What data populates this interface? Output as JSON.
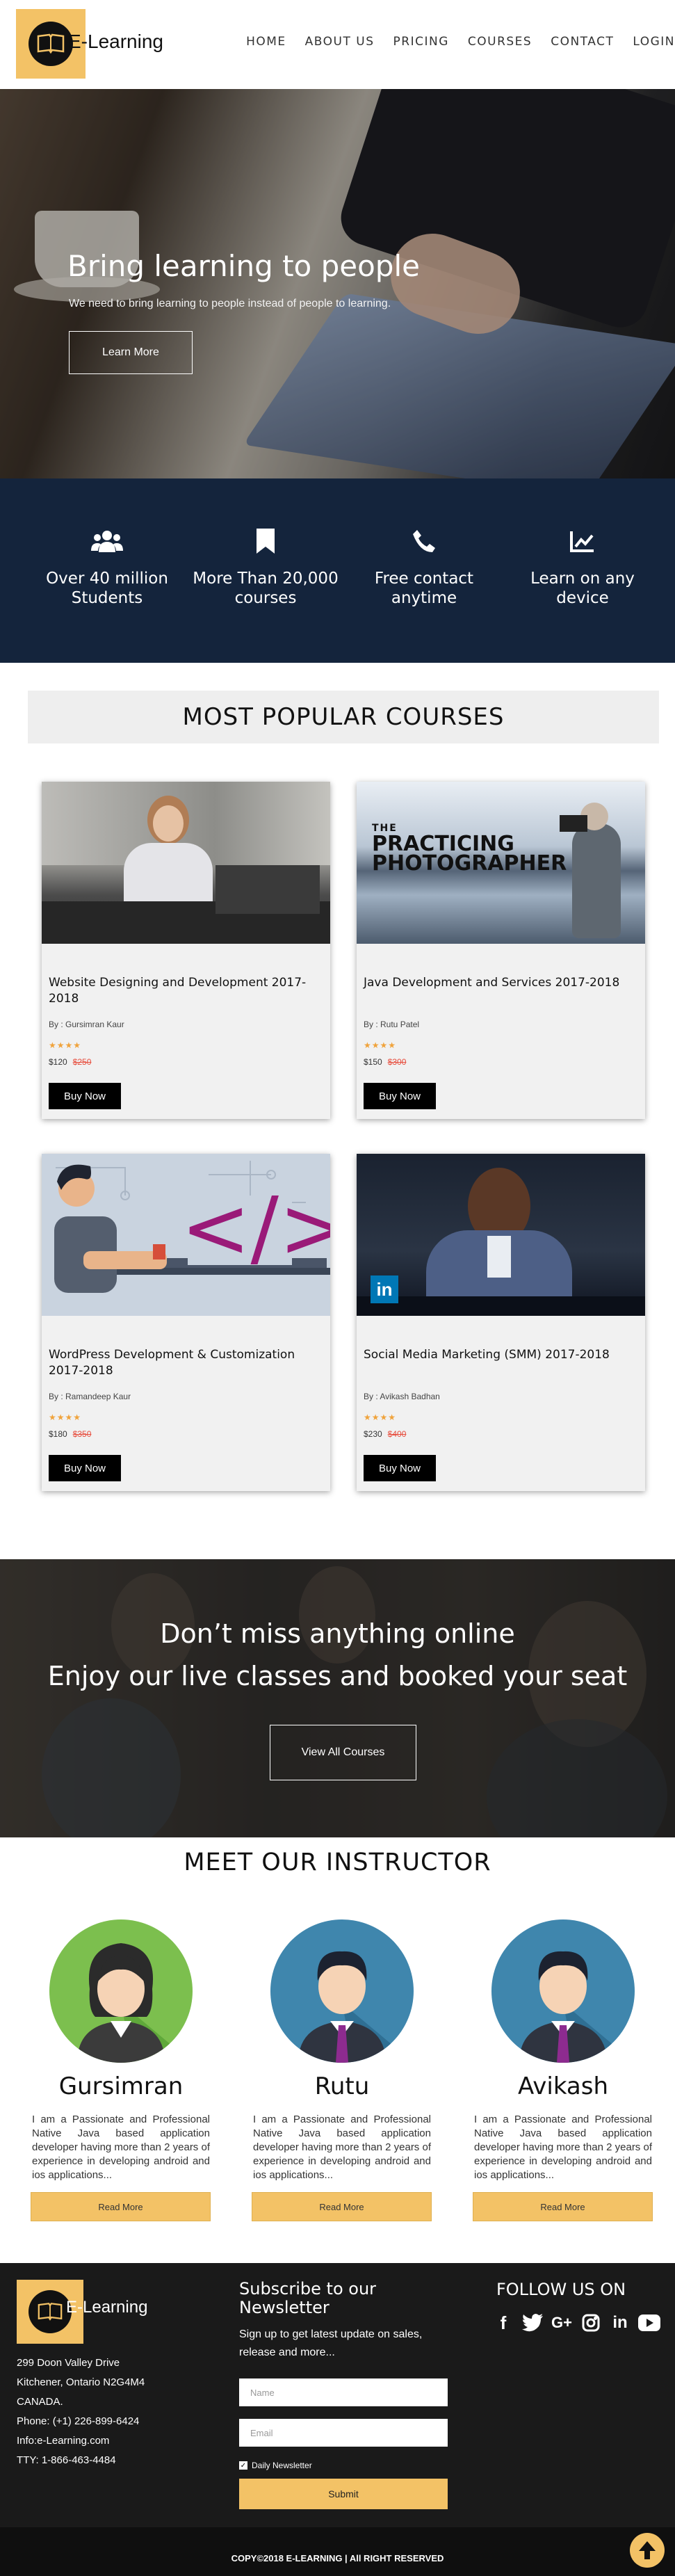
{
  "nav": {
    "logo_text": "E-Learning",
    "items": [
      "HOME",
      "ABOUT US",
      "PRICING",
      "COURSES",
      "CONTACT",
      "LOGIN"
    ]
  },
  "hero": {
    "title": "Bring learning to people",
    "subtitle": "We need to bring learning to people instead of people to learning.",
    "button": "Learn More"
  },
  "features": [
    {
      "icon": "users-icon",
      "text": "Over 40 million Students"
    },
    {
      "icon": "bookmark-icon",
      "text": "More Than 20,000 courses"
    },
    {
      "icon": "phone-icon",
      "text": "Free contact anytime"
    },
    {
      "icon": "chart-icon",
      "text": "Learn on any device"
    }
  ],
  "popular": {
    "title": "MOST POPULAR COURSES",
    "courses": [
      {
        "title": "Website Designing and Development 2017-2018",
        "by": "By : Gursimran Kaur",
        "stars": "★★★★",
        "price": "$120",
        "old_price": "$250",
        "button": "Buy Now"
      },
      {
        "title": "Java Development and Services 2017-2018",
        "by": "By : Rutu Patel",
        "stars": "★★★★",
        "price": "$150",
        "old_price": "$300",
        "button": "Buy Now",
        "image_text": "THE PRACTICING PHOTOGRAPHER"
      },
      {
        "title": "WordPress Development & Customization 2017-2018",
        "by": "By : Ramandeep Kaur",
        "stars": "★★★★",
        "price": "$180",
        "old_price": "$350",
        "button": "Buy Now"
      },
      {
        "title": "Social Media Marketing (SMM) 2017-2018",
        "by": "By : Avikash Badhan",
        "stars": "★★★★",
        "price": "$230",
        "old_price": "$400",
        "button": "Buy Now"
      }
    ]
  },
  "banner": {
    "line1": "Don’t miss anything online",
    "line2": "Enjoy our live classes and booked your seat",
    "button": "View All Courses"
  },
  "instructors": {
    "title": "MEET OUR INSTRUCTOR",
    "list": [
      {
        "name": "Gursimran",
        "desc": "I am a Passionate and Professional Native Java based application developer having more than 2 years of experience in developing android and ios applications...",
        "button": "Read More"
      },
      {
        "name": "Rutu",
        "desc": "I am a Passionate and Professional Native Java based application developer having more than 2 years of experience in developing android and ios applications...",
        "button": "Read More"
      },
      {
        "name": "Avikash",
        "desc": "I am a Passionate and Professional Native Java based application developer having more than 2 years of experience in developing android and ios applications...",
        "button": "Read More"
      }
    ]
  },
  "footer": {
    "logo_text": "E-Learning",
    "address": [
      "299 Doon Valley Drive",
      "Kitchener, Ontario N2G4M4",
      "CANADA.",
      "Phone: (+1) 226-899-6424",
      "Info:e-Learning.com",
      "TTY: 1-866-463-4484"
    ],
    "subscribe_title": "Subscribe to our Newsletter",
    "subscribe_text": "Sign up to get latest update on sales, release and more...",
    "name_placeholder": "Name",
    "email_placeholder": "Email",
    "checkbox_label": "Daily Newsletter",
    "submit": "Submit",
    "follow_title": "FOLLOW US ON",
    "social": [
      "f",
      "t",
      "G+",
      "ig",
      "in",
      "yt"
    ]
  },
  "copyright": "COPY©2018 E-LEARNING | All RIGHT RESERVED",
  "colors": {
    "accent": "#f3c266",
    "navy": "#14243c",
    "footer": "#1a1a1a"
  }
}
